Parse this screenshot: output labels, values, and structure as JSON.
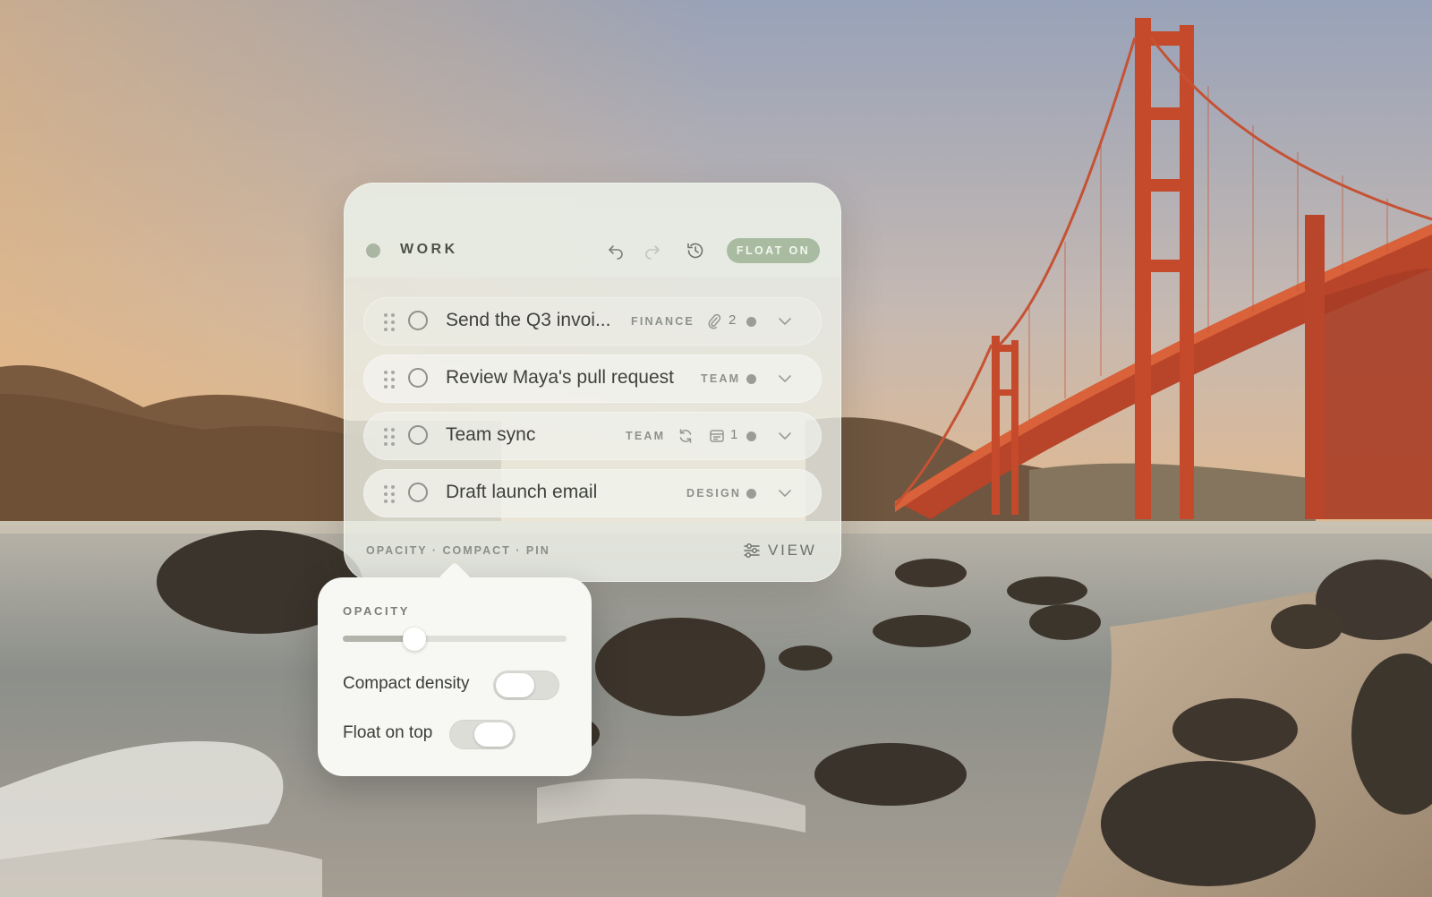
{
  "panel": {
    "list_name": "WORK",
    "float_badge": "FLOAT ON",
    "icons": [
      "undo-icon",
      "redo-icon",
      "history-icon"
    ],
    "tasks": [
      {
        "title": "Send the Q3 invoi...",
        "tag": "FINANCE",
        "meta_icon": "paperclip-icon",
        "meta_count": "2"
      },
      {
        "title": "Review Maya's pull request",
        "tag": "TEAM"
      },
      {
        "title": "Team sync",
        "tag": "TEAM",
        "meta_icon": "calendar-icon",
        "meta_count": "1",
        "extra_icon": "repeat-icon"
      },
      {
        "title": "Draft launch email",
        "tag": "DESIGN"
      }
    ],
    "footer_modes": "OPACITY · COMPACT · PIN",
    "view_label": "VIEW"
  },
  "popover": {
    "heading": "OPACITY",
    "opacity_value": 0.32,
    "compact_density_label": "Compact density",
    "compact_density_on": false,
    "float_on_top_label": "Float on top",
    "float_on_top_on": true
  },
  "colors": {
    "accent": "#a9bca1",
    "panel_bg": "#ecf0e8",
    "popover_bg": "#f7f7f3"
  }
}
